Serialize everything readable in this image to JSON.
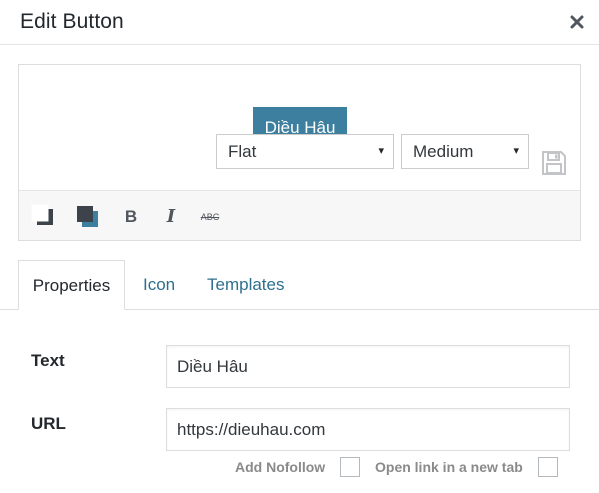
{
  "dialog": {
    "title": "Edit Button",
    "close_icon": "close-icon"
  },
  "preview": {
    "button_label": "Diều Hâu",
    "button_color": "#3d7f9e",
    "save_icon": "floppy-disk-icon"
  },
  "toolbar": {
    "text_color_icon": "text-color-swatch-icon",
    "background_color_icon": "background-color-swatch-icon",
    "bold_label": "B",
    "italic_label": "I",
    "strike_label": "ABC",
    "style_select": {
      "value": "Flat"
    },
    "size_select": {
      "value": "Medium"
    },
    "arrow": "▾"
  },
  "tabs": [
    {
      "label": "Properties",
      "active": true
    },
    {
      "label": "Icon",
      "active": false
    },
    {
      "label": "Templates",
      "active": false
    }
  ],
  "form": {
    "text": {
      "label": "Text",
      "value": "Diều Hâu"
    },
    "url": {
      "label": "URL",
      "value": "https://dieuhau.com"
    },
    "nofollow": {
      "label": "Add Nofollow",
      "checked": false
    },
    "new_tab": {
      "label": "Open link in a new tab",
      "checked": false
    }
  },
  "colors": {
    "accent": "#3d7f9e",
    "link": "#2e6f8e"
  }
}
